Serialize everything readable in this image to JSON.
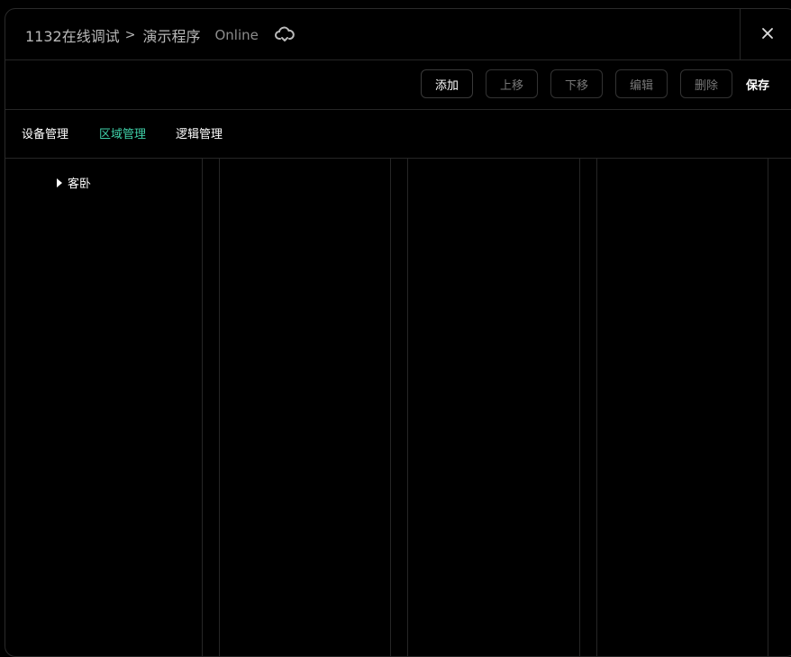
{
  "header": {
    "project": "1132在线调试",
    "separator": ">",
    "program": "演示程序",
    "status": "Online",
    "cloud_icon": "cloud-sync-icon",
    "close_icon": "close-icon"
  },
  "toolbar": {
    "add_label": "添加",
    "move_up_label": "上移",
    "move_down_label": "下移",
    "edit_label": "编辑",
    "delete_label": "删除",
    "save_label": "保存"
  },
  "tabs": [
    {
      "label": "设备管理",
      "selected": false
    },
    {
      "label": "区域管理",
      "selected": true
    },
    {
      "label": "逻辑管理",
      "selected": false
    }
  ],
  "tree": {
    "root_label": "客卧",
    "expand_icon": "caret-right-icon"
  },
  "colors": {
    "background": "#000000",
    "accent": "#3fd0a8",
    "border": "#262626",
    "muted_text": "#777777"
  }
}
